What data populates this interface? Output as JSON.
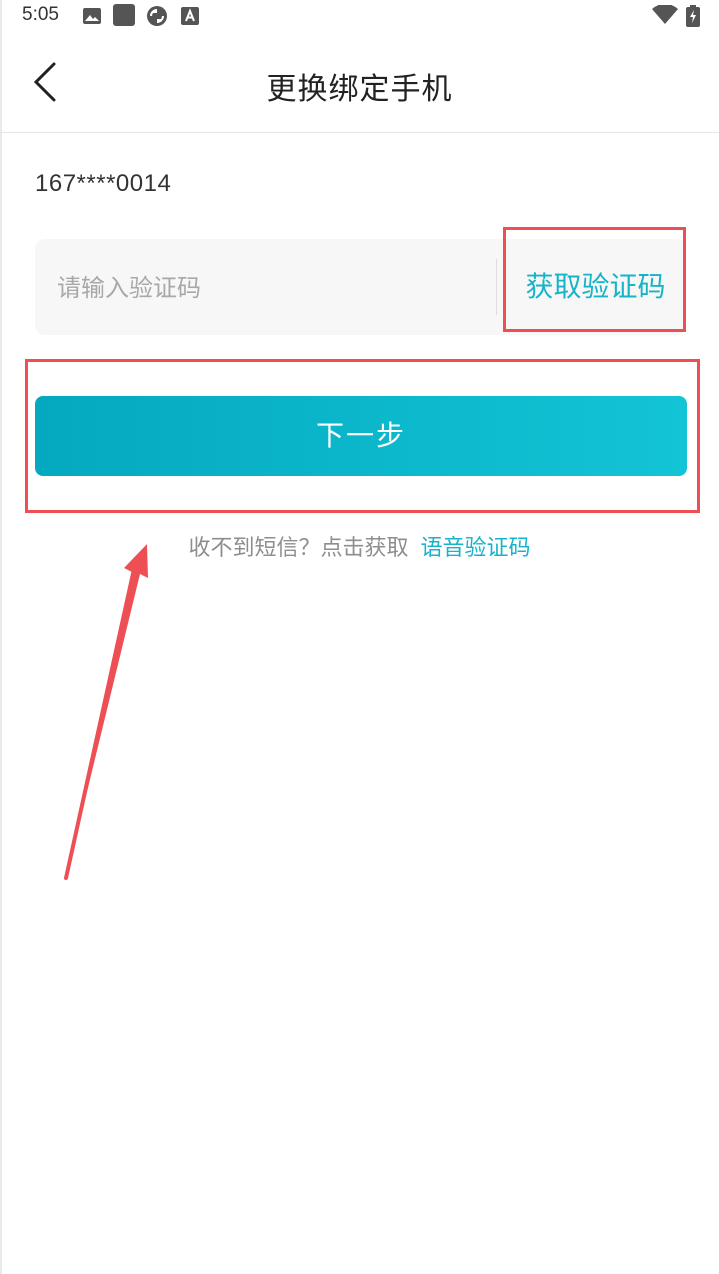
{
  "status_bar": {
    "time": "5:05",
    "icons": [
      "image-icon",
      "app-square-icon",
      "sync-icon",
      "text-a-icon"
    ],
    "right_icons": [
      "wifi-icon",
      "battery-charging-icon"
    ]
  },
  "header": {
    "title": "更换绑定手机",
    "back_icon": "chevron-left-icon"
  },
  "form": {
    "phone_number": "167****0014",
    "code_placeholder": "请输入验证码",
    "code_value": "",
    "get_code_label": "获取验证码",
    "next_label": "下一步"
  },
  "voice": {
    "hint": "收不到短信？点击获取",
    "link_label": "语音验证码"
  },
  "colors": {
    "accent": "#17b3c8",
    "button_gradient_start": "#04a9bf",
    "button_gradient_end": "#13c4d6",
    "annotation": "#ee4f55"
  }
}
